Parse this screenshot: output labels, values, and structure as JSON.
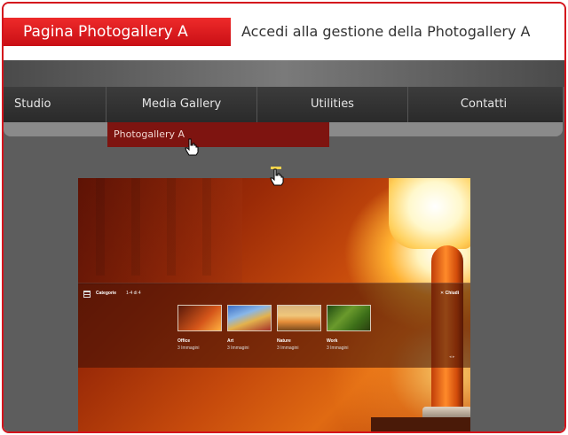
{
  "header": {
    "tab_title": "Pagina Photogallery A",
    "subtitle": "Accedi alla gestione della Photogallery A"
  },
  "nav": {
    "items": [
      {
        "label": "Studio"
      },
      {
        "label": "Media Gallery"
      },
      {
        "label": "Utilities"
      },
      {
        "label": "Contatti"
      }
    ],
    "dropdown_item": "Photogallery A"
  },
  "gallery": {
    "panel_title": "Categorie",
    "panel_count": "1-4 di 4",
    "close_label": "✕ Chiudi",
    "nav_arrows": "◂ ▸",
    "categories": [
      {
        "name": "Office",
        "sub": "3 Immagini"
      },
      {
        "name": "Art",
        "sub": "3 Immagini"
      },
      {
        "name": "Nature",
        "sub": "3 Immagini"
      },
      {
        "name": "Work",
        "sub": "3 Immagini"
      }
    ]
  },
  "colors": {
    "brand_red": "#d4141c",
    "dropdown_bg": "#7e1410",
    "nav_bg": "#2f2f2f"
  },
  "icons": [
    "hand-cursor-icon",
    "list-icon",
    "close-icon"
  ]
}
